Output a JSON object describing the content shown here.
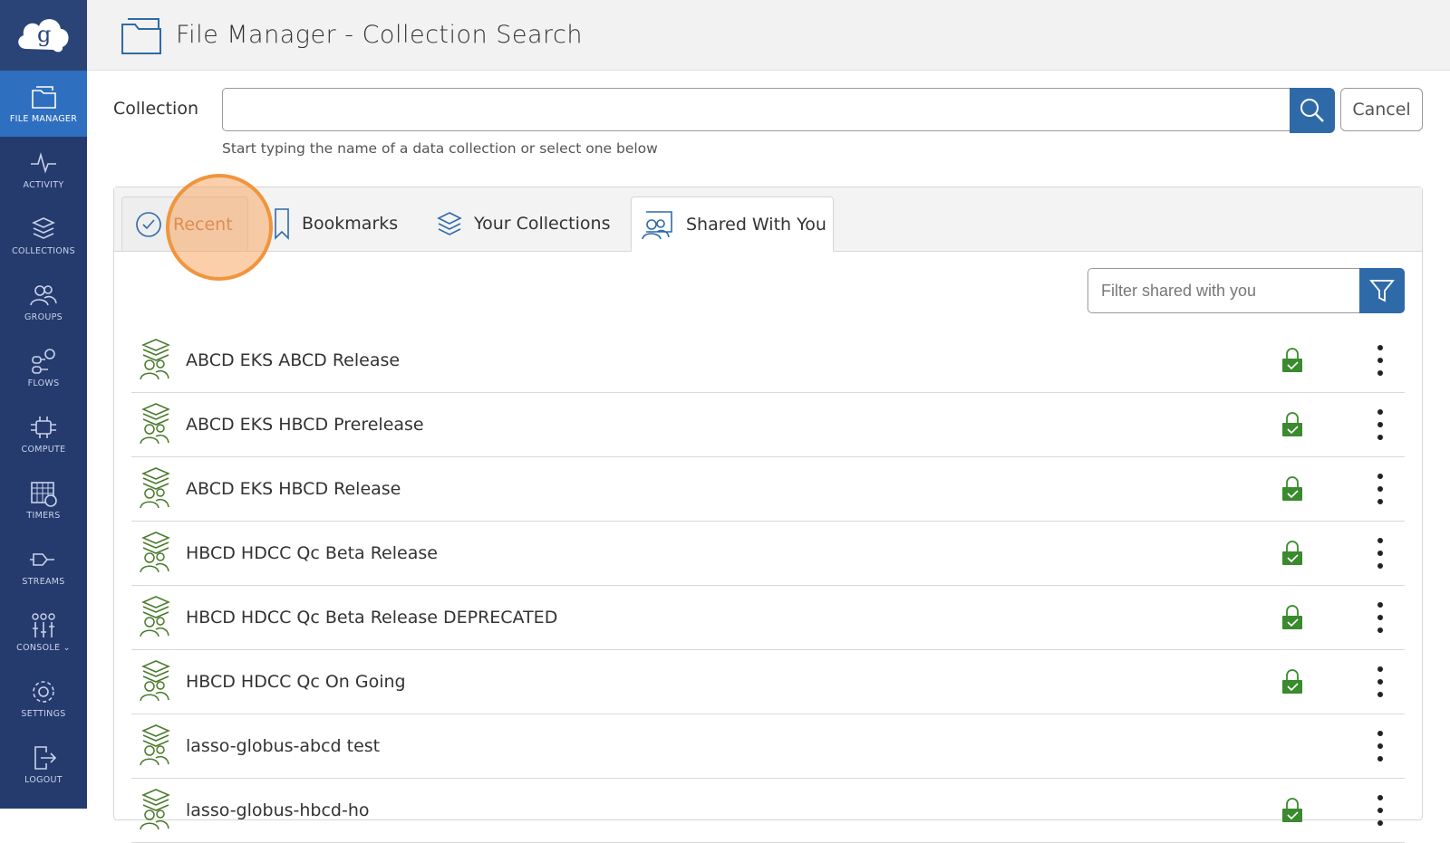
{
  "sidebar": {
    "items": [
      {
        "label": "FILE MANAGER",
        "icon": "file-manager-icon",
        "active": true
      },
      {
        "label": "ACTIVITY",
        "icon": "activity-icon"
      },
      {
        "label": "COLLECTIONS",
        "icon": "collections-icon"
      },
      {
        "label": "GROUPS",
        "icon": "groups-icon"
      },
      {
        "label": "FLOWS",
        "icon": "flows-icon"
      },
      {
        "label": "COMPUTE",
        "icon": "compute-icon"
      },
      {
        "label": "TIMERS",
        "icon": "timers-icon"
      },
      {
        "label": "STREAMS",
        "icon": "streams-icon"
      },
      {
        "label": "CONSOLE",
        "icon": "console-icon"
      },
      {
        "label": "SETTINGS",
        "icon": "settings-icon"
      },
      {
        "label": "LOGOUT",
        "icon": "logout-icon"
      }
    ]
  },
  "header": {
    "title": "File Manager - Collection Search"
  },
  "search": {
    "label": "Collection",
    "value": "",
    "hint": "Start typing the name of a data collection or select one below",
    "cancel_label": "Cancel"
  },
  "tabs": {
    "recent": "Recent",
    "bookmarks": "Bookmarks",
    "your_collections": "Your Collections",
    "shared_with_you": "Shared With You",
    "active": "Shared With You"
  },
  "filter": {
    "placeholder": "Filter shared with you"
  },
  "collections": [
    {
      "name": "ABCD EKS ABCD Release",
      "locked": true
    },
    {
      "name": "ABCD EKS HBCD Prerelease",
      "locked": true
    },
    {
      "name": "ABCD EKS HBCD Release",
      "locked": true
    },
    {
      "name": "HBCD HDCC Qc Beta Release",
      "locked": true
    },
    {
      "name": "HBCD HDCC Qc Beta Release DEPRECATED",
      "locked": true
    },
    {
      "name": "HBCD HDCC Qc On Going",
      "locked": true
    },
    {
      "name": "lasso-globus-abcd test",
      "locked": false
    },
    {
      "name": "lasso-globus-hbcd-ho",
      "locked": true
    }
  ],
  "colors": {
    "sidebar": "#253b6e",
    "accent": "#2f6aa8",
    "lock": "#3a8a2e",
    "collection_icon": "#4a7a2a"
  }
}
